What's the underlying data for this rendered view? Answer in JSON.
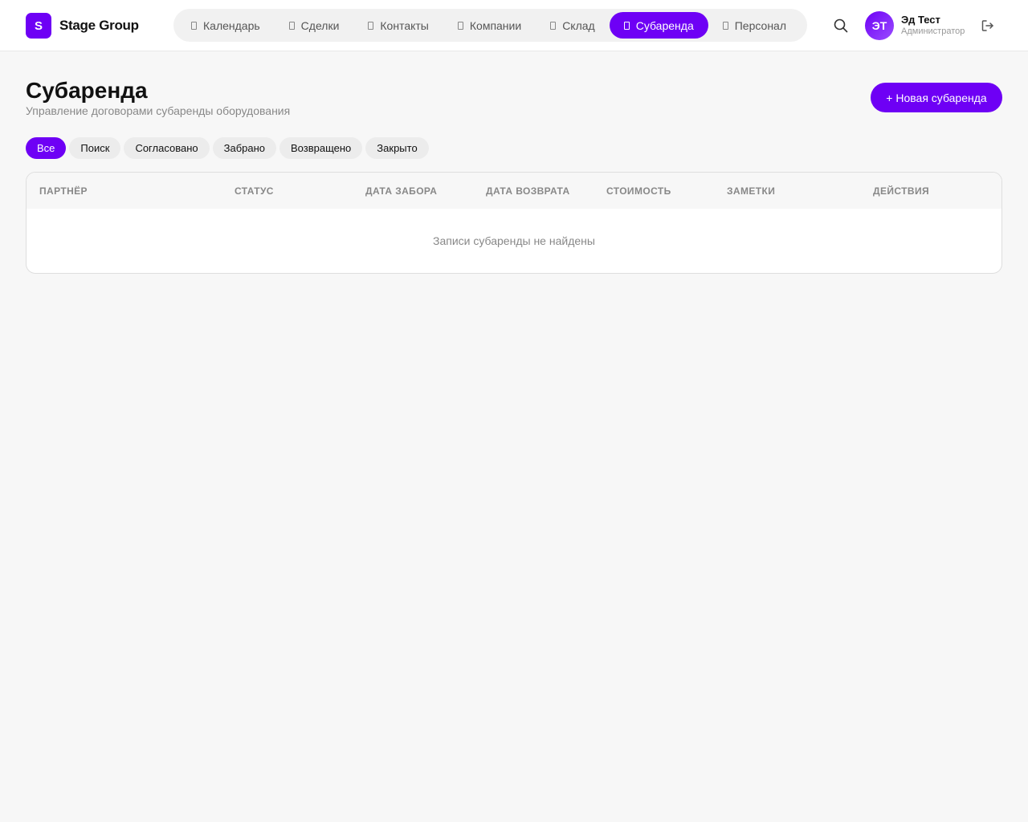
{
  "brand": {
    "logo_letter": "S",
    "name": "Stage Group"
  },
  "nav": {
    "items": [
      {
        "label": "Календарь",
        "icon": "calendar-icon",
        "active": false
      },
      {
        "label": "Сделки",
        "icon": "deals-icon",
        "active": false
      },
      {
        "label": "Контакты",
        "icon": "contacts-icon",
        "active": false
      },
      {
        "label": "Компании",
        "icon": "companies-icon",
        "active": false
      },
      {
        "label": "Склад",
        "icon": "warehouse-icon",
        "active": false
      },
      {
        "label": "Субаренда",
        "icon": "subrent-icon",
        "active": true
      },
      {
        "label": "Персонал",
        "icon": "staff-icon",
        "active": false
      }
    ]
  },
  "user": {
    "initials": "ЭТ",
    "name": "Эд Тест",
    "role": "Администратор"
  },
  "page": {
    "title": "Субаренда",
    "subtitle": "Управление договорами субаренды оборудования",
    "new_button": "+ Новая субаренда"
  },
  "filters": [
    {
      "label": "Все",
      "active": true
    },
    {
      "label": "Поиск",
      "active": false
    },
    {
      "label": "Согласовано",
      "active": false
    },
    {
      "label": "Забрано",
      "active": false
    },
    {
      "label": "Возвращено",
      "active": false
    },
    {
      "label": "Закрыто",
      "active": false
    }
  ],
  "table": {
    "columns": [
      "Партнёр",
      "Статус",
      "Дата забора",
      "Дата возврата",
      "Стоимость",
      "Заметки",
      "Действия"
    ],
    "empty_text": "Записи субаренды не найдены"
  },
  "colors": {
    "accent": "#6e00f5",
    "background": "#f7f7f7"
  }
}
